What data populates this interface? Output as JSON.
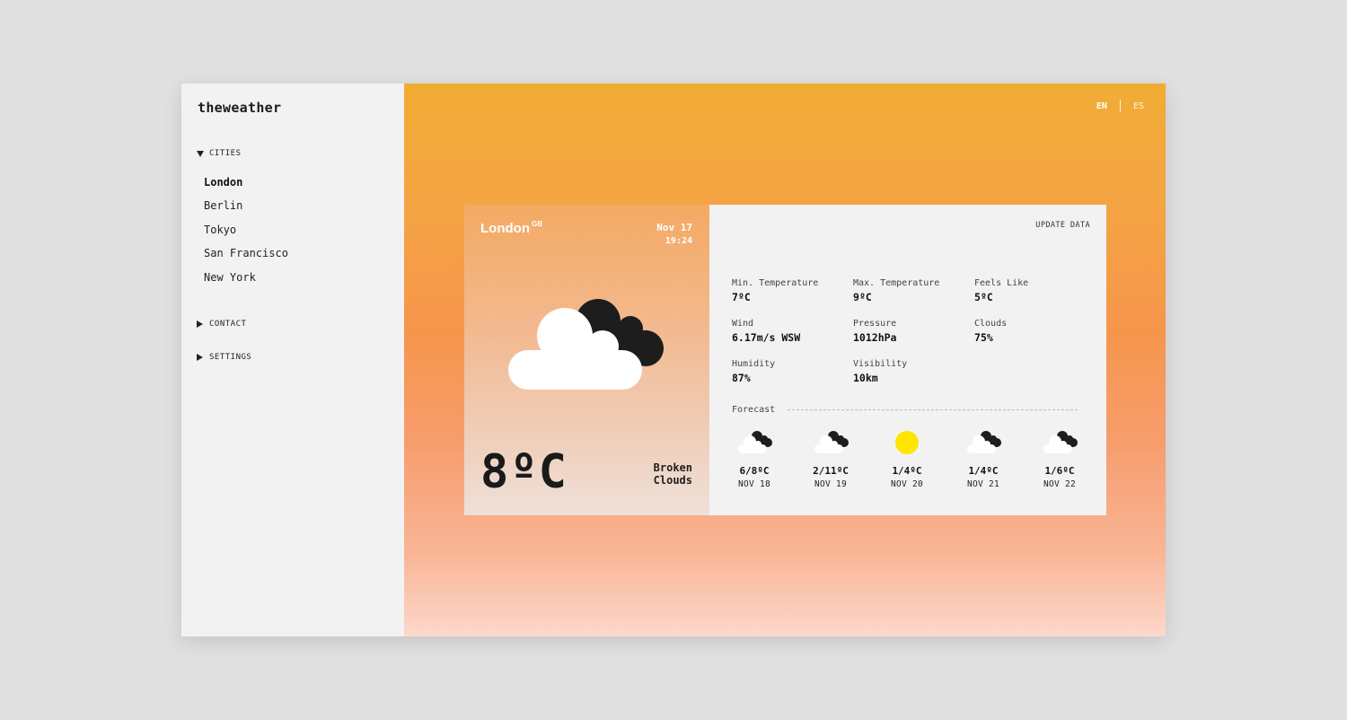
{
  "app": {
    "logo": "theweather"
  },
  "sidebar": {
    "cities_label": "CITIES",
    "cities": [
      "London",
      "Berlin",
      "Tokyo",
      "San Francisco",
      "New York"
    ],
    "contact_label": "CONTACT",
    "settings_label": "SETTINGS"
  },
  "lang": {
    "en": "EN",
    "es": "ES"
  },
  "current": {
    "city": "London",
    "country": "GB",
    "date": "Nov 17",
    "time": "19:24",
    "temp": "8ºC",
    "description_line1": "Broken",
    "description_line2": "Clouds",
    "icon": "broken-clouds-icon"
  },
  "details": {
    "update_label": "UPDATE DATA",
    "min_temp": {
      "label": "Min. Temperature",
      "value": "7ºC"
    },
    "max_temp": {
      "label": "Max. Temperature",
      "value": "9ºC"
    },
    "feels_like": {
      "label": "Feels Like",
      "value": "5ºC"
    },
    "wind": {
      "label": "Wind",
      "value": "6.17m/s WSW"
    },
    "pressure": {
      "label": "Pressure",
      "value": "1012hPa"
    },
    "clouds": {
      "label": "Clouds",
      "value": "75%"
    },
    "humidity": {
      "label": "Humidity",
      "value": "87%"
    },
    "visibility": {
      "label": "Visibility",
      "value": "10km"
    }
  },
  "forecast": {
    "label": "Forecast",
    "days": [
      {
        "temp": "6/8ºC",
        "date": "NOV 18",
        "icon": "broken-clouds-icon"
      },
      {
        "temp": "2/11ºC",
        "date": "NOV 19",
        "icon": "broken-clouds-icon"
      },
      {
        "temp": "1/4ºC",
        "date": "NOV 20",
        "icon": "sun-icon"
      },
      {
        "temp": "1/4ºC",
        "date": "NOV 21",
        "icon": "broken-clouds-icon"
      },
      {
        "temp": "1/6ºC",
        "date": "NOV 22",
        "icon": "broken-clouds-icon"
      }
    ]
  },
  "colors": {
    "sidebar_bg": "#f2f2f2",
    "gradient_top": "#f1ac34",
    "gradient_bottom": "#fcd8cb",
    "sun": "#ffe600",
    "cloud_dark": "#1d1d1d",
    "cloud_light": "#ffffff"
  }
}
